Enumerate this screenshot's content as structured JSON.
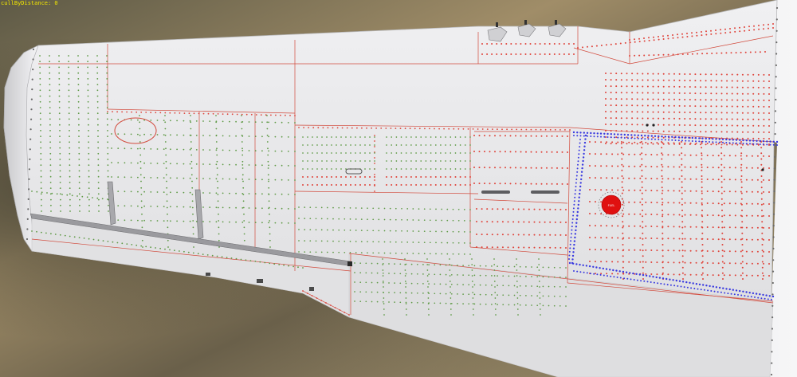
{
  "viewport": {
    "debug_text": "cullByDistance: 0"
  },
  "scene": {
    "background_colors": [
      "#6f6650",
      "#9a8a66",
      "#4f4a3a",
      "#b8a57e"
    ],
    "wing_color": "#e4e4e6",
    "panel_line_color": "#d24a3c",
    "rivet_colors": {
      "red": "#e0433a",
      "green": "#5f9a46",
      "blue": "#3a3ae0"
    },
    "roundel_color": "#e01010",
    "icons": [
      "wing-mesh",
      "fuel-cap-roundel",
      "pitot-probe",
      "aileron-hinge"
    ]
  }
}
